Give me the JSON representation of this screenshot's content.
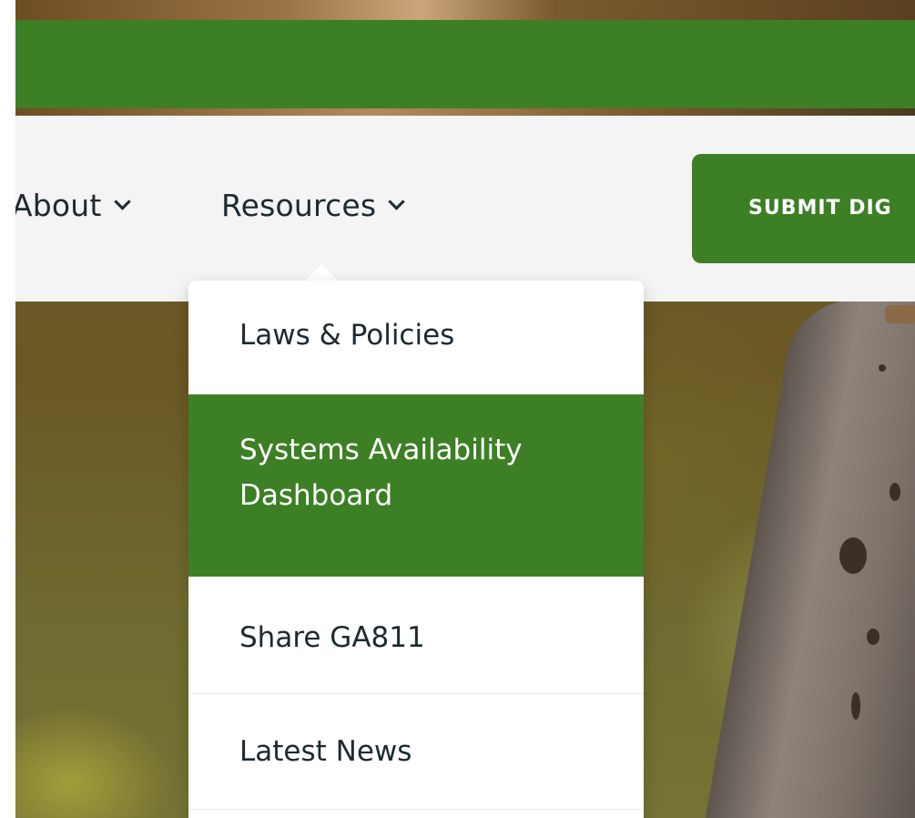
{
  "nav": {
    "items": [
      {
        "label": "About"
      },
      {
        "label": "Resources"
      }
    ],
    "submit_label": "SUBMIT DIG"
  },
  "dropdown": {
    "items": [
      {
        "label": "Laws & Policies"
      },
      {
        "label_line1": "Systems Availability",
        "label_line2": "Dashboard",
        "active": true
      },
      {
        "label": "Share GA811"
      },
      {
        "label": "Latest News"
      }
    ]
  },
  "colors": {
    "brand_green": "#3d7f25",
    "nav_background": "#f4f4f4",
    "text_dark": "#1d2a30"
  }
}
